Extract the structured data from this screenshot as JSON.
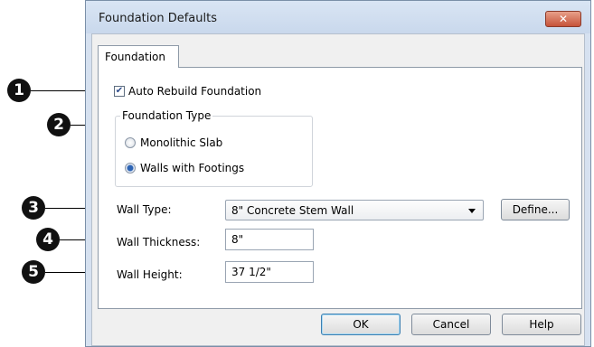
{
  "window": {
    "title": "Foundation Defaults",
    "close_glyph": "✕"
  },
  "tabs": [
    {
      "label": "Foundation"
    }
  ],
  "auto_rebuild": {
    "label": "Auto Rebuild Foundation",
    "checked": true
  },
  "foundation_type": {
    "legend": "Foundation Type",
    "options": [
      {
        "label": "Monolithic Slab",
        "checked": false
      },
      {
        "label": "Walls with Footings",
        "checked": true
      }
    ]
  },
  "wall_type": {
    "label": "Wall Type:",
    "value": "8\" Concrete Stem Wall"
  },
  "define_button": "Define...",
  "wall_thickness": {
    "label": "Wall Thickness:",
    "value": "8\""
  },
  "wall_height": {
    "label": "Wall Height:",
    "value": "37 1/2\""
  },
  "buttons": {
    "ok": "OK",
    "cancel": "Cancel",
    "help": "Help"
  },
  "callouts": [
    "1",
    "2",
    "3",
    "4",
    "5"
  ],
  "colors": {
    "titlebar": "#c9d8ec",
    "callout": "#111111",
    "default_button_border": "#3c7fb1"
  }
}
